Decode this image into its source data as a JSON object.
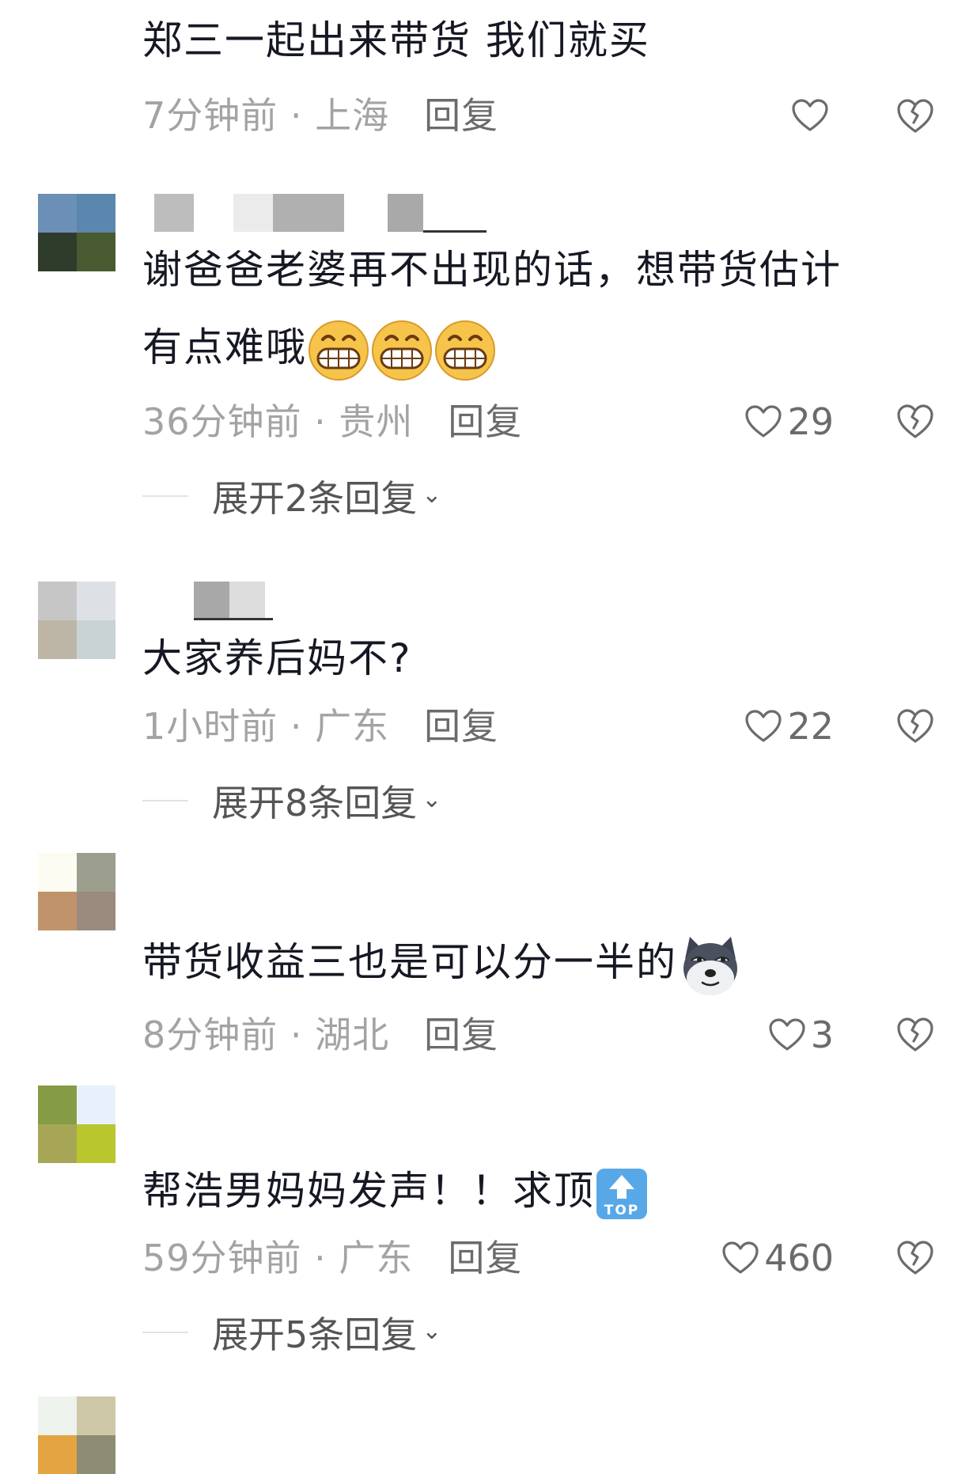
{
  "comments": [
    {
      "text": "郑三一起出来带货 我们就买",
      "time": "7分钟前",
      "region": "上海",
      "reply_label": "回复",
      "likes": "",
      "avatar_colors": [
        "#e8603f",
        "#f4856a",
        "#ffffff",
        "#ffffff"
      ]
    },
    {
      "text_line1": "谢爸爸老婆再不出现的话，想带货估计",
      "text_line2": "有点难哦",
      "emojis": [
        "grin-emoji",
        "grin-emoji",
        "grin-emoji"
      ],
      "time": "36分钟前",
      "region": "贵州",
      "reply_label": "回复",
      "likes": "29",
      "expand_label": "展开2条回复",
      "avatar_colors": [
        "#6b8fb6",
        "#5b86ad",
        "#2f3b2b",
        "#4a5a30"
      ]
    },
    {
      "text": "大家养后妈不?",
      "time": "1小时前",
      "region": "广东",
      "reply_label": "回复",
      "likes": "22",
      "expand_label": "展开8条回复",
      "avatar_colors": [
        "#c6c6c6",
        "#dde1e6",
        "#bdb6a6",
        "#c9d3d6"
      ]
    },
    {
      "text": "带货收益三也是可以分一半的",
      "emojis": [
        "husky-emoji"
      ],
      "time": "8分钟前",
      "region": "湖北",
      "reply_label": "回复",
      "likes": "3",
      "avatar_colors": [
        "#fdfcf2",
        "#9c9f8e",
        "#c1936b",
        "#9b8a7e"
      ]
    },
    {
      "text": "帮浩男妈妈发声！！求顶",
      "emojis": [
        "top-arrow-emoji"
      ],
      "time": "59分钟前",
      "region": "广东",
      "reply_label": "回复",
      "likes": "460",
      "expand_label": "展开5条回复",
      "avatar_colors": [
        "#869b46",
        "#e8f1fb",
        "#a7a657",
        "#b9c62e"
      ]
    },
    {
      "avatar_colors": [
        "#eef3ee",
        "#cfc8a6",
        "#e3a441",
        "#8d8d73"
      ]
    }
  ],
  "separator": " · ",
  "emoji_top_text": "TOP",
  "colors": {
    "text": "#161823",
    "meta": "#a3a3a3",
    "reply": "#6b6b6b"
  }
}
